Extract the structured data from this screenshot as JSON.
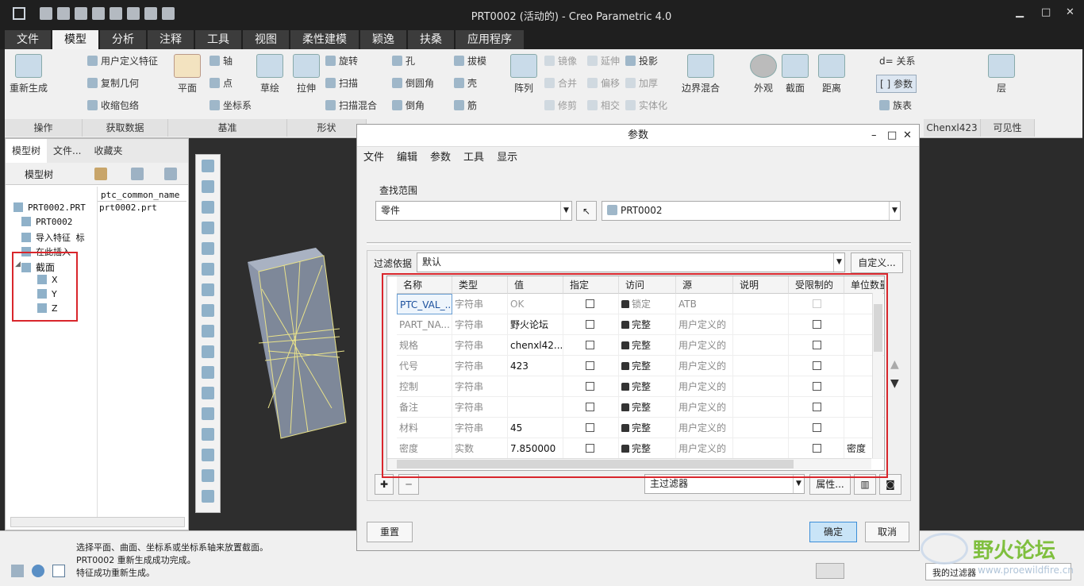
{
  "window": {
    "title": "PRT0002 (活动的) - Creo Parametric 4.0"
  },
  "menu_tabs": [
    "文件",
    "模型",
    "分析",
    "注释",
    "工具",
    "视图",
    "柔性建模",
    "颖逸",
    "扶桑",
    "应用程序"
  ],
  "active_tab": "模型",
  "ribbon": {
    "regen": "重新生成",
    "udf": "用户定义特征",
    "copy_geom": "复制几何",
    "shrinkwrap": "收缩包络",
    "plane": "平面",
    "axis": "轴",
    "point": "点",
    "csys": "坐标系",
    "sketch": "草绘",
    "extrude": "拉伸",
    "revolve": "旋转",
    "sweep": "扫描",
    "sweep_blend": "扫描混合",
    "hole": "孔",
    "round": "倒圆角",
    "chamfer": "倒角",
    "draft": "拔模",
    "shell": "壳",
    "rib": "筋",
    "pattern": "阵列",
    "mirror": "镜像",
    "merge": "合并",
    "trim": "修剪",
    "extend": "延伸",
    "offset": "偏移",
    "intersect": "相交",
    "project": "投影",
    "thicken": "加厚",
    "solidify": "实体化",
    "boundary_blend": "边界混合",
    "appearance": "外观",
    "section": "截面",
    "distance": "距离",
    "relations": "关系",
    "parameters": "参数",
    "family_table": "族表",
    "layer": "层",
    "groups": [
      "操作",
      "获取数据",
      "基准",
      "形状",
      "Chenxl423",
      "可见性"
    ]
  },
  "left_panel": {
    "tabs": [
      "模型树",
      "文件...",
      "收藏夹"
    ],
    "header": "模型树",
    "col2": "ptc_common_name",
    "rows": [
      {
        "name": "PRT0002.PRT",
        "val": "prt0002.prt"
      },
      {
        "name": "PRT0002",
        "val": ""
      },
      {
        "name": "导入特征 标",
        "val": ""
      },
      {
        "name": "在此插入",
        "val": ""
      },
      {
        "name": "截面",
        "val": ""
      },
      {
        "name": "X",
        "val": ""
      },
      {
        "name": "Y",
        "val": ""
      },
      {
        "name": "Z",
        "val": ""
      }
    ]
  },
  "status": {
    "lines": [
      "选择平面、曲面、坐标系或坐标系轴来放置截面。",
      "PRT0002 重新生成成功完成。",
      "特征成功重新生成。"
    ],
    "filter": "我的过滤器"
  },
  "watermark": {
    "brand": "野火论坛",
    "url": "www.proewildfire.cn"
  },
  "dialog": {
    "title": "参数",
    "menu": [
      "文件",
      "编辑",
      "参数",
      "工具",
      "显示"
    ],
    "scope_label": "查找范围",
    "scope_type": "零件",
    "scope_object": "PRT0002",
    "filter_label": "过滤依据",
    "filter_value": "默认",
    "customize": "自定义...",
    "columns": [
      "名称",
      "类型",
      "值",
      "指定",
      "访问",
      "源",
      "说明",
      "受限制的",
      "单位数量"
    ],
    "rows": [
      {
        "name": "PTC_VAL_...",
        "type": "字符串",
        "value": "OK",
        "access": "锁定",
        "source": "ATB",
        "unit": ""
      },
      {
        "name": "PART_NA...",
        "type": "字符串",
        "value": "野火论坛",
        "access": "完整",
        "source": "用户定义的",
        "unit": ""
      },
      {
        "name": "规格",
        "type": "字符串",
        "value": "chenxl42...",
        "access": "完整",
        "source": "用户定义的",
        "unit": ""
      },
      {
        "name": "代号",
        "type": "字符串",
        "value": "423",
        "access": "完整",
        "source": "用户定义的",
        "unit": ""
      },
      {
        "name": "控制",
        "type": "字符串",
        "value": "",
        "access": "完整",
        "source": "用户定义的",
        "unit": ""
      },
      {
        "name": "备注",
        "type": "字符串",
        "value": "",
        "access": "完整",
        "source": "用户定义的",
        "unit": ""
      },
      {
        "name": "材料",
        "type": "字符串",
        "value": "45",
        "access": "完整",
        "source": "用户定义的",
        "unit": ""
      },
      {
        "name": "密度",
        "type": "实数",
        "value": "7.850000",
        "access": "完整",
        "source": "用户定义的",
        "unit": "密度"
      }
    ],
    "main_filter": "主过滤器",
    "properties": "属性...",
    "reset": "重置",
    "ok": "确定",
    "cancel": "取消"
  }
}
